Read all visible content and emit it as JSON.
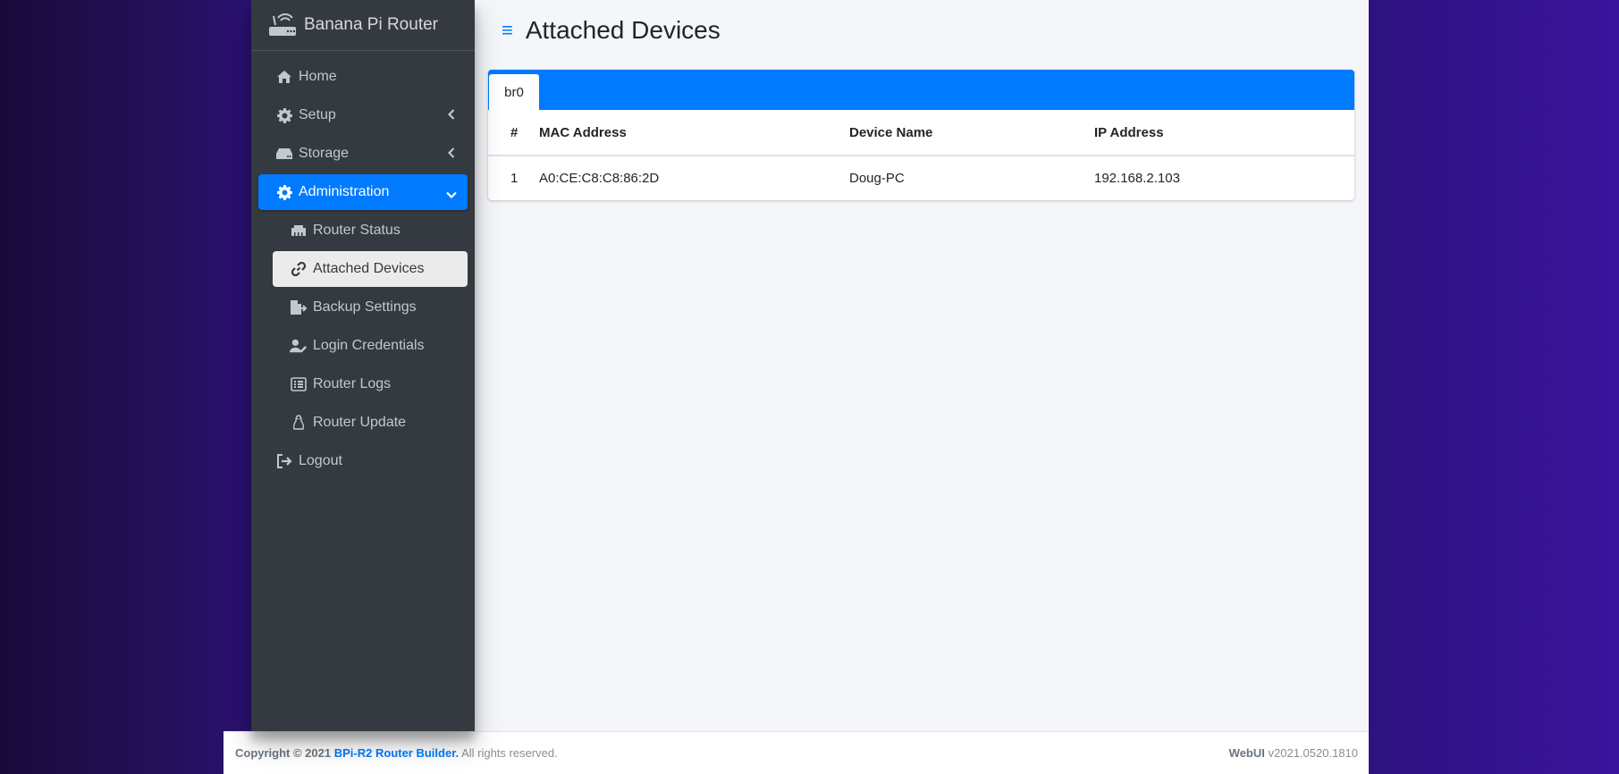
{
  "brand": {
    "name": "Banana Pi Router"
  },
  "sidebar": {
    "items": [
      {
        "label": "Home",
        "icon": "home-icon"
      },
      {
        "label": "Setup",
        "icon": "gear-icon"
      },
      {
        "label": "Storage",
        "icon": "hdd-icon"
      },
      {
        "label": "Administration",
        "icon": "gear-icon"
      }
    ],
    "subitems": [
      {
        "label": "Router Status",
        "icon": "ethernet-icon"
      },
      {
        "label": "Attached Devices",
        "icon": "link-icon"
      },
      {
        "label": "Backup Settings",
        "icon": "file-export-icon"
      },
      {
        "label": "Login Credentials",
        "icon": "user-edit-icon"
      },
      {
        "label": "Router Logs",
        "icon": "list-icon"
      },
      {
        "label": "Router Update",
        "icon": "linux-icon"
      }
    ],
    "logout": {
      "label": "Logout",
      "icon": "sign-out-icon"
    }
  },
  "header": {
    "title": "Attached Devices"
  },
  "tabs": [
    {
      "label": "br0"
    }
  ],
  "table": {
    "headers": [
      "#",
      "MAC Address",
      "Device Name",
      "IP Address"
    ],
    "rows": [
      [
        "1",
        "A0:CE:C8:C8:86:2D",
        "Doug-PC",
        "192.168.2.103"
      ]
    ]
  },
  "footer": {
    "copyright": "Copyright © 2021",
    "link": "BPi-R2 Router Builder.",
    "rights": "All rights reserved.",
    "webui_label": "WebUI",
    "version": "v2021.0520.1810"
  },
  "colors": {
    "accent": "#007bff",
    "sidebar": "#343a40",
    "content": "#f4f6f9"
  }
}
